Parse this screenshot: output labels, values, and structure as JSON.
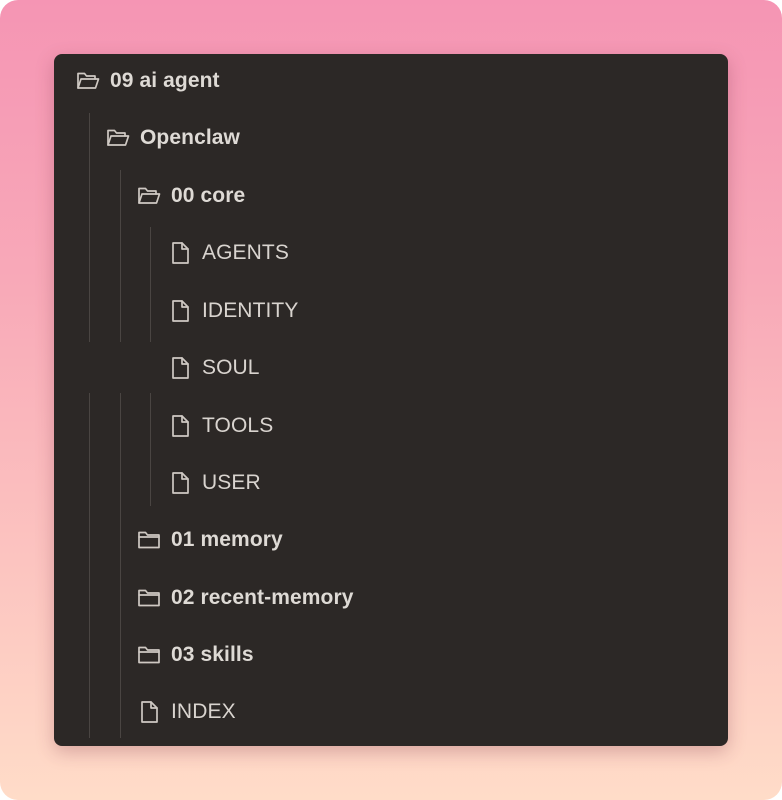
{
  "colors": {
    "panel_background": "#2c2826",
    "text": "#e2ddd8",
    "icon_stroke": "#cfc9c3",
    "guide_line": "#4a4542",
    "backdrop_top": "#f595b4",
    "backdrop_bottom": "#ffdcc8"
  },
  "tree": {
    "items": [
      {
        "label": "09 ai agent",
        "kind": "folder",
        "icon": "folder-open-icon",
        "expanded": true
      },
      {
        "label": "Openclaw",
        "kind": "folder",
        "icon": "folder-open-icon",
        "expanded": true
      },
      {
        "label": "00 core",
        "kind": "folder",
        "icon": "folder-open-icon",
        "expanded": true
      },
      {
        "label": "AGENTS",
        "kind": "file",
        "icon": "file-icon"
      },
      {
        "label": "IDENTITY",
        "kind": "file",
        "icon": "file-icon"
      },
      {
        "label": "SOUL",
        "kind": "file",
        "icon": "file-icon"
      },
      {
        "label": "TOOLS",
        "kind": "file",
        "icon": "file-icon"
      },
      {
        "label": "USER",
        "kind": "file",
        "icon": "file-icon"
      },
      {
        "label": "01 memory",
        "kind": "folder",
        "icon": "folder-closed-icon",
        "expanded": false
      },
      {
        "label": "02 recent-memory",
        "kind": "folder",
        "icon": "folder-closed-icon",
        "expanded": false
      },
      {
        "label": "03 skills",
        "kind": "folder",
        "icon": "folder-closed-icon",
        "expanded": false
      },
      {
        "label": "INDEX",
        "kind": "file",
        "icon": "file-icon"
      }
    ]
  }
}
